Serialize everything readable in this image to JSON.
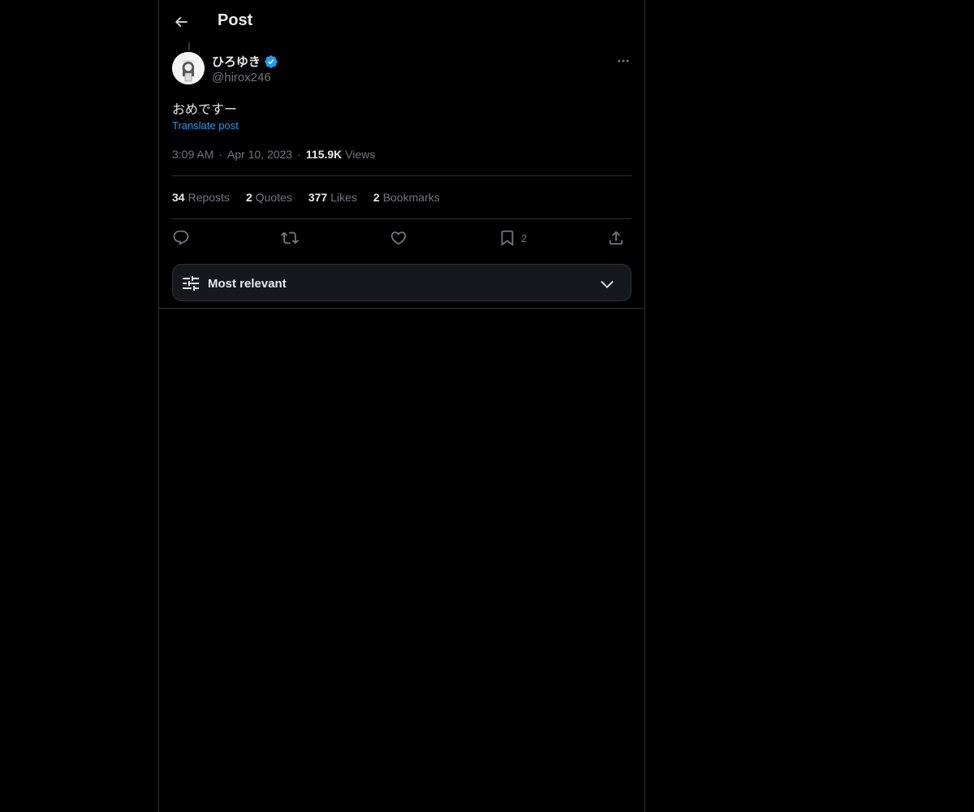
{
  "header": {
    "title": "Post",
    "back_icon": "arrow-left-icon"
  },
  "author": {
    "display_name": "ひろゆき",
    "handle": "@hirox246",
    "verified": true,
    "verified_color": "#1d9bf0"
  },
  "post": {
    "text": "おめですー",
    "translate_label": "Translate post",
    "time": "3:09 AM",
    "date": "Apr 10, 2023",
    "separator": "·",
    "views_count": "115.9K",
    "views_label": "Views"
  },
  "stats": [
    {
      "count": "34",
      "label": "Reposts"
    },
    {
      "count": "2",
      "label": "Quotes"
    },
    {
      "count": "377",
      "label": "Likes"
    },
    {
      "count": "2",
      "label": "Bookmarks"
    }
  ],
  "actions": {
    "reply_icon": "reply-icon",
    "repost_icon": "repost-icon",
    "like_icon": "heart-icon",
    "bookmark_icon": "bookmark-icon",
    "bookmark_count": "2",
    "share_icon": "share-icon"
  },
  "sort": {
    "label": "Most relevant",
    "icon": "sliders-icon",
    "chevron": "chevron-down-icon"
  },
  "colors": {
    "background": "#000000",
    "text": "#e7e9ea",
    "muted": "#71767b",
    "accent": "#1d9bf0",
    "border": "#2f3336"
  }
}
